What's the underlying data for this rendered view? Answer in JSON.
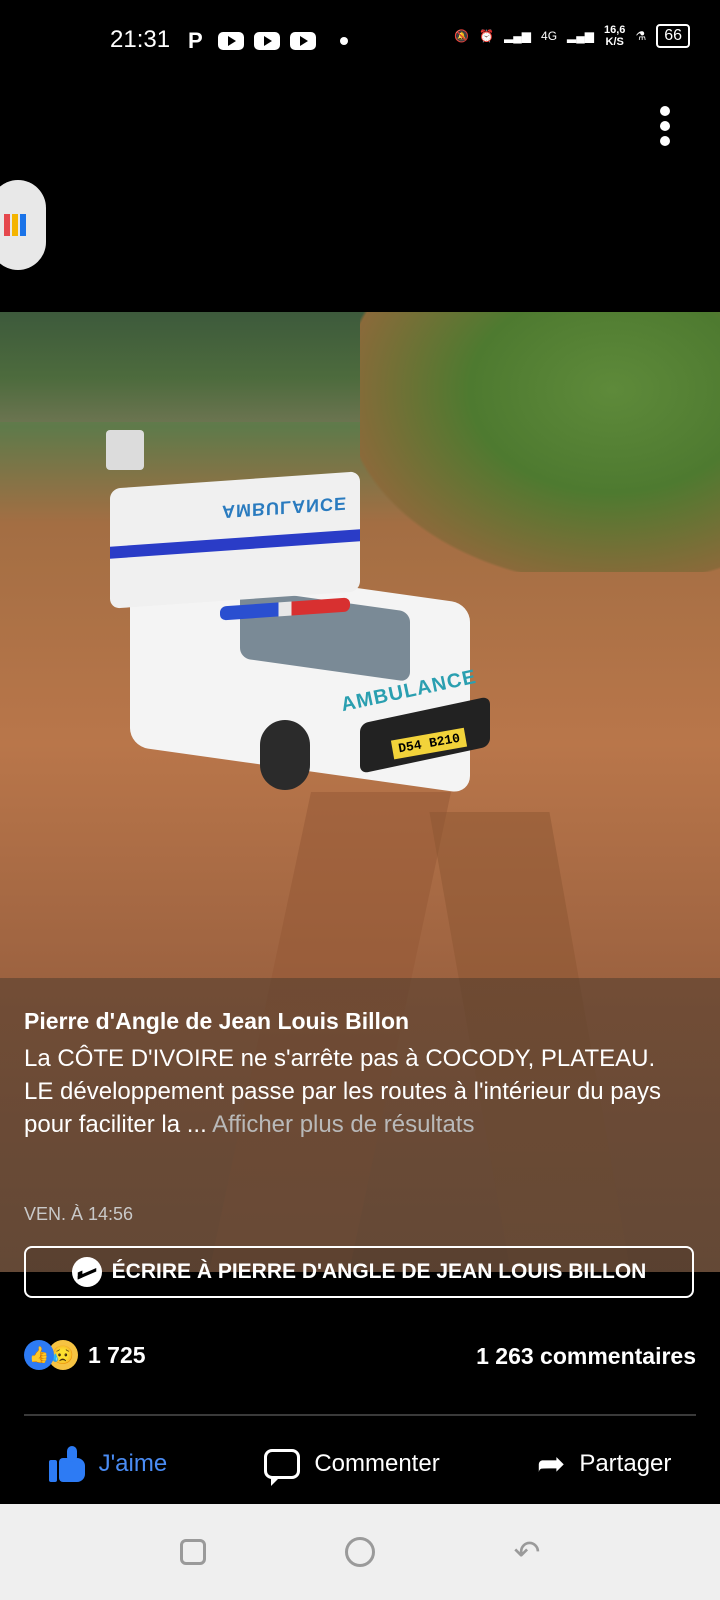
{
  "status_bar": {
    "time": "21:31",
    "network": "4G",
    "speed_value": "16,6",
    "speed_unit": "K/S",
    "battery": "66"
  },
  "post": {
    "author": "Pierre d'Angle de Jean Louis Billon",
    "caption_line1": "La CÔTE D'IVOIRE ne s'arrête pas à COCODY, PLATEAU.",
    "caption_line2": "LE développement passe par les routes à l'intérieur du pays pour faciliter la ...",
    "see_more": "Afficher plus de résultats",
    "timestamp": "VEN. À 14:56",
    "message_button": "ÉCRIRE À PIERRE D'ANGLE DE JEAN LOUIS BILLON"
  },
  "photo": {
    "box_text": "AMBULANCE",
    "hood_text": "AMBULANCE",
    "plate": "D54 B210"
  },
  "engagement": {
    "reaction_count": "1 725",
    "comment_count": "1 263 commentaires"
  },
  "actions": {
    "like": "J'aime",
    "comment": "Commenter",
    "share": "Partager"
  },
  "colors": {
    "like_blue": "#2d7bf4",
    "background": "#000000"
  }
}
